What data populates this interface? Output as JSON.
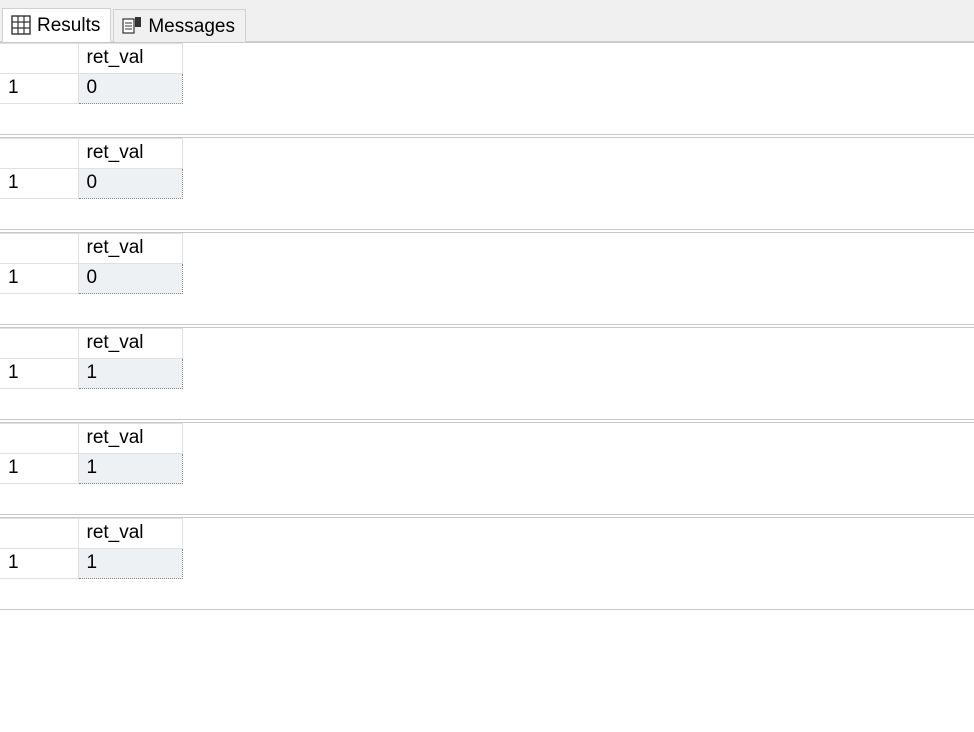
{
  "tabs": {
    "results": "Results",
    "messages": "Messages"
  },
  "column_header": "ret_val",
  "row_label": "1",
  "result_sets": [
    {
      "value": "0"
    },
    {
      "value": "0"
    },
    {
      "value": "0"
    },
    {
      "value": "1"
    },
    {
      "value": "1"
    },
    {
      "value": "1"
    }
  ]
}
